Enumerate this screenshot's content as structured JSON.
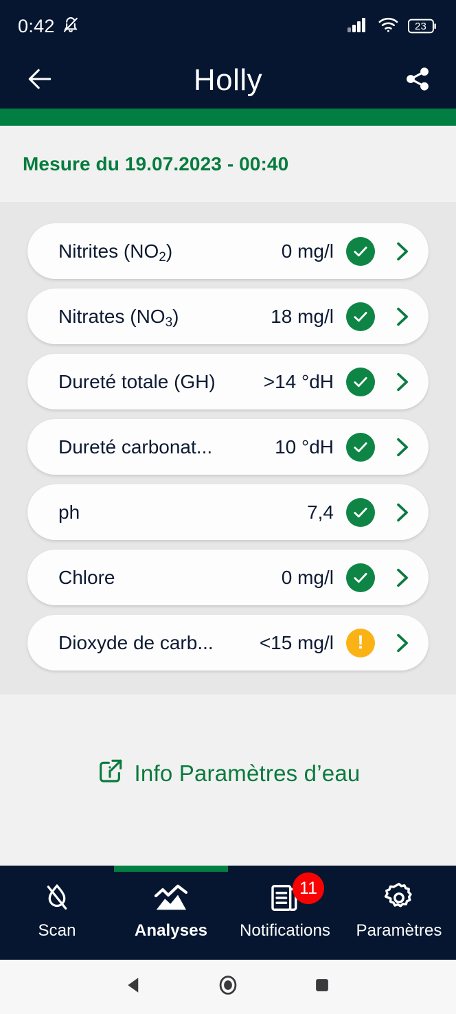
{
  "status_bar": {
    "clock": "0:42",
    "mute_icon": "bell-slash-icon",
    "signal_icon": "cellular-signal-icon",
    "wifi_icon": "wifi-icon",
    "battery_level": "23"
  },
  "app_bar": {
    "back_icon": "arrow-left-icon",
    "title": "Holly",
    "share_icon": "share-icon"
  },
  "measurement": {
    "date_label": "Mesure du 19.07.2023 - 00:40"
  },
  "parameters": [
    {
      "label_main": "Nitrites (NO",
      "label_sub": "2",
      "label_tail": ")",
      "value": "0 mg/l",
      "status": "ok",
      "status_icon": "check-circle-icon",
      "chevron_icon": "chevron-right-icon"
    },
    {
      "label_main": "Nitrates (NO",
      "label_sub": "3",
      "label_tail": ")",
      "value": "18 mg/l",
      "status": "ok",
      "status_icon": "check-circle-icon",
      "chevron_icon": "chevron-right-icon"
    },
    {
      "label_main": "Dureté totale (GH)",
      "label_sub": "",
      "label_tail": "",
      "value": ">14 °dH",
      "status": "ok",
      "status_icon": "check-circle-icon",
      "chevron_icon": "chevron-right-icon"
    },
    {
      "label_main": "Dureté carbonat...",
      "label_sub": "",
      "label_tail": "",
      "value": "10 °dH",
      "status": "ok",
      "status_icon": "check-circle-icon",
      "chevron_icon": "chevron-right-icon"
    },
    {
      "label_main": "ph",
      "label_sub": "",
      "label_tail": "",
      "value": "7,4",
      "status": "ok",
      "status_icon": "check-circle-icon",
      "chevron_icon": "chevron-right-icon"
    },
    {
      "label_main": "Chlore",
      "label_sub": "",
      "label_tail": "",
      "value": "0 mg/l",
      "status": "ok",
      "status_icon": "check-circle-icon",
      "chevron_icon": "chevron-right-icon"
    },
    {
      "label_main": "Dioxyde de carb...",
      "label_sub": "",
      "label_tail": "",
      "value": "<15 mg/l",
      "status": "warn",
      "status_icon": "warning-circle-icon",
      "chevron_icon": "chevron-right-icon"
    }
  ],
  "info_link": {
    "icon": "info-external-link-icon",
    "label": "Info Paramètres d’eau"
  },
  "tabs": [
    {
      "label": "Scan",
      "icon": "water-drop-scan-icon",
      "active": false,
      "badge": ""
    },
    {
      "label": "Analyses",
      "icon": "chart-mountain-icon",
      "active": true,
      "badge": ""
    },
    {
      "label": "Notifications",
      "icon": "document-list-icon",
      "active": false,
      "badge": "11"
    },
    {
      "label": "Paramètres",
      "icon": "gear-icon",
      "active": false,
      "badge": ""
    }
  ],
  "system_nav": {
    "back_icon": "android-back-icon",
    "home_icon": "android-home-icon",
    "recents_icon": "android-recents-icon"
  },
  "colors": {
    "header_navy": "#061630",
    "accent_green": "#017f42",
    "text_green": "#067c3e",
    "status_ok": "#0e8545",
    "status_warn": "#fbb215",
    "badge_red": "#f80303",
    "page_bg": "#f1f1f1",
    "list_bg": "#e7e7e7"
  }
}
